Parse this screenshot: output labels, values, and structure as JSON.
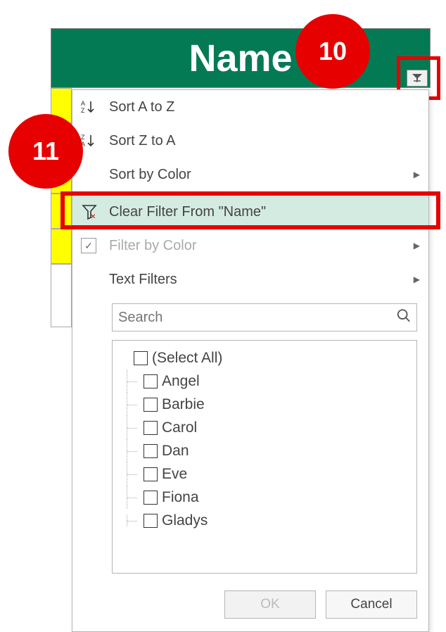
{
  "header": {
    "title": "Name"
  },
  "callouts": {
    "ten": "10",
    "eleven": "11"
  },
  "menu": {
    "sort_az": "Sort A to Z",
    "sort_za": "Sort Z to A",
    "sort_color": "Sort by Color",
    "clear_filter": "Clear Filter From \"Name\"",
    "filter_color": "Filter by Color",
    "text_filters": "Text Filters"
  },
  "search": {
    "placeholder": "Search"
  },
  "tree": {
    "items": [
      {
        "label": "(Select All)"
      },
      {
        "label": "Angel"
      },
      {
        "label": "Barbie"
      },
      {
        "label": "Carol"
      },
      {
        "label": "Dan"
      },
      {
        "label": "Eve"
      },
      {
        "label": "Fiona"
      },
      {
        "label": "Gladys"
      }
    ]
  },
  "buttons": {
    "ok": "OK",
    "cancel": "Cancel"
  }
}
